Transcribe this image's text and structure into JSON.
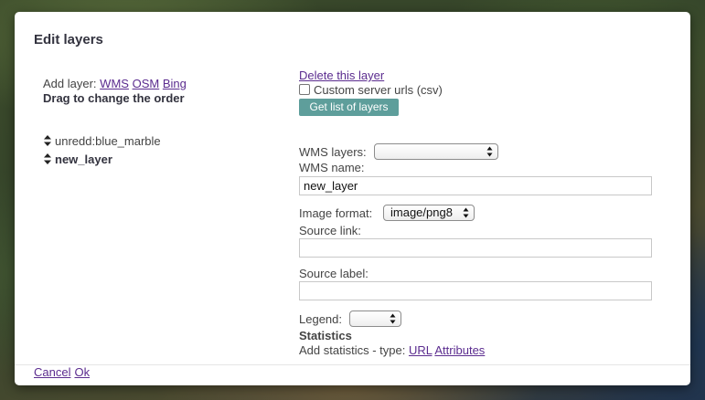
{
  "dialog": {
    "title": "Edit layers",
    "add_layer_label": "Add layer:",
    "add_layer_links": [
      "WMS",
      "OSM",
      "Bing"
    ],
    "drag_hint": "Drag to change the order",
    "layers": [
      {
        "name": "unredd:blue_marble",
        "selected": false
      },
      {
        "name": "new_layer",
        "selected": true
      }
    ],
    "delete_link": "Delete this layer",
    "custom_urls_label": "Custom server urls (csv)",
    "custom_urls_checked": false,
    "get_layers_button": "Get list of layers",
    "wms_layers_label": "WMS layers:",
    "wms_layers_value": "",
    "wms_name_label": "WMS name:",
    "wms_name_value": "new_layer",
    "image_format_label": "Image format:",
    "image_format_value": "image/png8",
    "source_link_label": "Source link:",
    "source_link_value": "",
    "source_label_label": "Source label:",
    "source_label_value": "",
    "legend_label": "Legend:",
    "legend_value": "",
    "statistics_heading": "Statistics",
    "add_statistics_label": "Add statistics - type:",
    "statistics_links": [
      "URL",
      "Attributes"
    ],
    "cancel_link": "Cancel",
    "ok_link": "Ok"
  },
  "icons": {
    "sort_icon": "sort-arrows-icon",
    "select_arrows": "select-arrows-icon"
  },
  "colors": {
    "link": "#5b2c8f",
    "button_bg": "#5e9e9b",
    "title": "#33333f"
  }
}
